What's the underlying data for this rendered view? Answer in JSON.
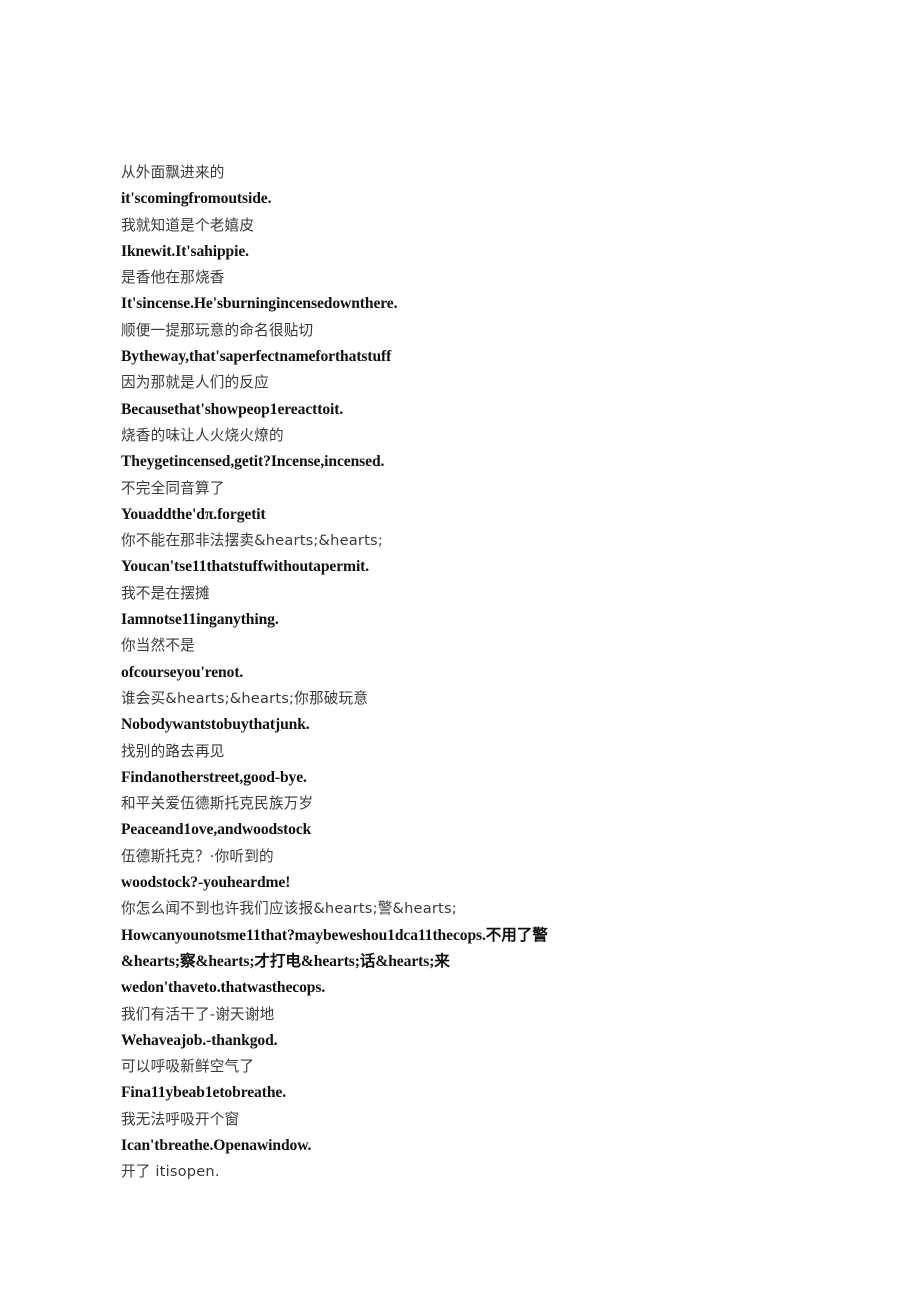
{
  "document": {
    "background_color": "#ffffff",
    "cjk_text_color": "#3a3a3a",
    "latin_text_color": "#111111",
    "lines": [
      {
        "id": "l1",
        "script": "cjk",
        "text": "从外面飘进来的"
      },
      {
        "id": "l2",
        "script": "latin",
        "text": "it'scomingfromoutside."
      },
      {
        "id": "l3",
        "script": "cjk",
        "text": "我就知道是个老嬉皮"
      },
      {
        "id": "l4",
        "script": "latin",
        "text": "Iknewit.It'sahippie."
      },
      {
        "id": "l5",
        "script": "cjk",
        "text": "是香他在那烧香"
      },
      {
        "id": "l6",
        "script": "latin",
        "text": "It'sincense.He'sburningincensedownthere."
      },
      {
        "id": "l7",
        "script": "cjk",
        "text": "顺便一提那玩意的命名很贴切"
      },
      {
        "id": "l8",
        "script": "latin",
        "text": "Bytheway,that'saperfectnameforthatstuff"
      },
      {
        "id": "l9",
        "script": "cjk",
        "text": "因为那就是人们的反应"
      },
      {
        "id": "l10",
        "script": "latin",
        "text": "Becausethat'showpeop1ereacttoit."
      },
      {
        "id": "l11",
        "script": "cjk",
        "text": "烧香的味让人火烧火燎的"
      },
      {
        "id": "l12",
        "script": "latin",
        "text": "Theygetincensed,getit?Incense,incensed."
      },
      {
        "id": "l13",
        "script": "cjk",
        "text": "不完全同音算了"
      },
      {
        "id": "l14",
        "script": "latin",
        "text": "Youaddthe'dπ.forgetit"
      },
      {
        "id": "l15",
        "script": "cjk",
        "text": "你不能在那非法摆卖&hearts;&hearts;"
      },
      {
        "id": "l16",
        "script": "latin",
        "text": "Youcan'tse11thatstuffwithoutapermit."
      },
      {
        "id": "l17",
        "script": "cjk",
        "text": "我不是在摆摊"
      },
      {
        "id": "l18",
        "script": "latin",
        "text": "Iamnotse11inganything."
      },
      {
        "id": "l19",
        "script": "cjk",
        "text": "你当然不是"
      },
      {
        "id": "l20",
        "script": "latin",
        "text": "ofcourseyou'renot."
      },
      {
        "id": "l21",
        "script": "cjk",
        "text": "谁会买&hearts;&hearts;你那破玩意"
      },
      {
        "id": "l22",
        "script": "latin",
        "text": "Nobodywantstobuythatjunk."
      },
      {
        "id": "l23",
        "script": "cjk",
        "text": "找别的路去再见"
      },
      {
        "id": "l24",
        "script": "latin",
        "text": "Findanotherstreet,good-bye."
      },
      {
        "id": "l25",
        "script": "cjk",
        "text": "和平关爱伍德斯托克民族万岁"
      },
      {
        "id": "l26",
        "script": "latin",
        "text": "Peaceand1ove,andwoodstock"
      },
      {
        "id": "l27",
        "script": "cjk",
        "text": "伍德斯托克？·你听到的"
      },
      {
        "id": "l28",
        "script": "latin",
        "text": "woodstock?-youheardme!"
      },
      {
        "id": "l29",
        "script": "cjk",
        "text": "你怎么闻不到也许我们应该报&hearts;警&hearts;"
      },
      {
        "id": "l30",
        "script": "mixed",
        "text": "Howcanyounotsme11that?maybeweshou1dca11thecops.不用了警&hearts;察&hearts;才打电&hearts;话&hearts;来"
      },
      {
        "id": "l31",
        "script": "latin",
        "text": "wedon'thaveto.thatwasthecops."
      },
      {
        "id": "l32",
        "script": "cjk",
        "text": "我们有活干了-谢天谢地"
      },
      {
        "id": "l33",
        "script": "latin",
        "text": "Wehaveajob.-thankgod."
      },
      {
        "id": "l34",
        "script": "cjk",
        "text": "可以呼吸新鲜空气了"
      },
      {
        "id": "l35",
        "script": "latin",
        "text": "Fina11ybeab1etobreathe."
      },
      {
        "id": "l36",
        "script": "cjk",
        "text": "我无法呼吸开个窗"
      },
      {
        "id": "l37",
        "script": "latin",
        "text": "Ican'tbreathe.Openawindow."
      },
      {
        "id": "l38",
        "script": "cjk",
        "text": "开了 itisopen."
      }
    ]
  }
}
